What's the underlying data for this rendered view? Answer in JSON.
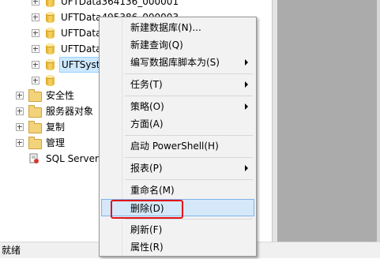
{
  "tree": {
    "databases": [
      {
        "label": "UFTData364136_000001"
      },
      {
        "label": "UFTData495386_000003"
      },
      {
        "label": "UFTData"
      },
      {
        "label": "UFTData"
      },
      {
        "label": "UFTSyst"
      }
    ],
    "folders": [
      {
        "label": "安全性"
      },
      {
        "label": "服务器对象"
      },
      {
        "label": "复制"
      },
      {
        "label": "管理"
      }
    ],
    "agent": {
      "label": "SQL Server"
    }
  },
  "context_menu": {
    "items": [
      {
        "label": "新建数据库(N)..."
      },
      {
        "label": "新建查询(Q)"
      },
      {
        "label": "编写数据库脚本为(S)"
      },
      {
        "label": "任务(T)"
      },
      {
        "label": "策略(O)"
      },
      {
        "label": "方面(A)"
      },
      {
        "label": "启动 PowerShell(H)"
      },
      {
        "label": "报表(P)"
      },
      {
        "label": "重命名(M)"
      },
      {
        "label": "删除(D)"
      },
      {
        "label": "刷新(F)"
      },
      {
        "label": "属性(R)"
      }
    ]
  },
  "statusbar": {
    "text": "就绪"
  },
  "colors": {
    "highlight": "#d5e8fa",
    "annotation": "#e0141b",
    "selection": "#cce8ff"
  }
}
